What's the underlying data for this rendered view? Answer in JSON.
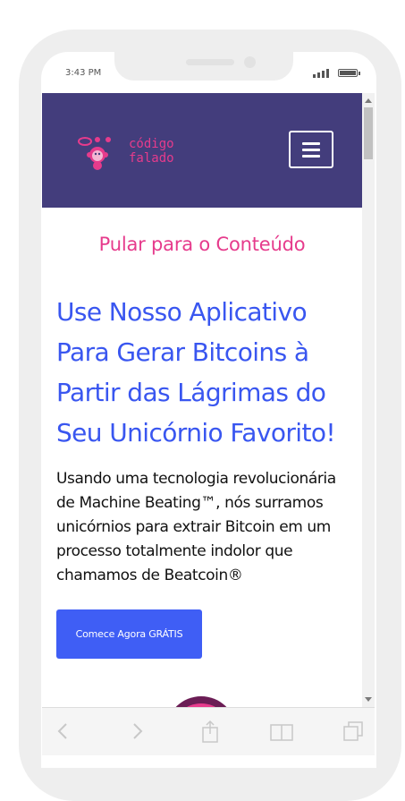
{
  "status_bar": {
    "time": "3:43 PM"
  },
  "header": {
    "logo_text_line1": "código",
    "logo_text_line2": "falado",
    "menu_icon": "hamburger-icon",
    "brand_color": "#433d7c",
    "accent_color": "#e63b8c"
  },
  "main": {
    "skip_link": "Pular para o Conteúdo",
    "hero_title": "Use Nosso Aplicativo Para Gerar Bitcoins à Partir das Lágrimas do Seu Unicórnio Favorito!",
    "hero_text": "Usando uma tecnologia revolucionária de Machine Beating™, nós surramos unicórnios para extrair Bitcoin em um processo totalmente indolor que chamamos de Beatcoin®",
    "cta_label": "Comece Agora GRÁTIS",
    "title_color": "#3956f0",
    "button_color": "#3f5ef5"
  },
  "toolbar": {
    "icons": [
      "back-icon",
      "forward-icon",
      "share-icon",
      "bookmarks-icon",
      "tabs-icon"
    ]
  }
}
